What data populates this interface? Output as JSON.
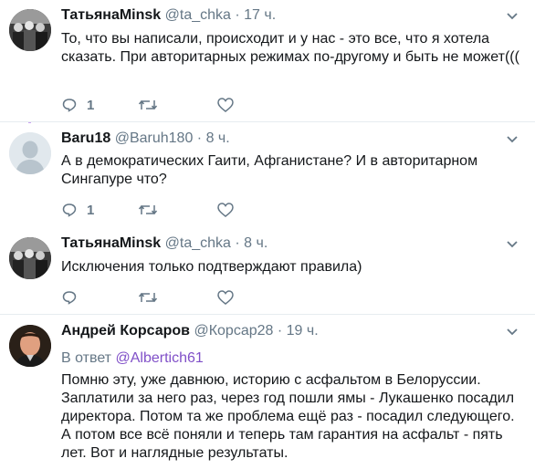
{
  "tweets": [
    {
      "name": "ТатьянаMinsk",
      "handle": "@ta_chka",
      "separator": "·",
      "time": "17 ч.",
      "text": "То, что вы написали, происходит и у нас -  это все, что я хотела сказать. При авторитарных режимах по-другому и быть не может(((",
      "reply_count": "1",
      "avatar_icon": "group-photo-avatar"
    },
    {
      "name": "Baru18",
      "handle": "@Baruh180",
      "separator": "·",
      "time": "8 ч.",
      "text": "А в демократических Гаити,  Афганистане? И в авторитарном Сингапуре что?",
      "reply_count": "1",
      "avatar_icon": "default-user-avatar"
    },
    {
      "name": "ТатьянаMinsk",
      "handle": "@ta_chka",
      "separator": "·",
      "time": "8 ч.",
      "text": "Исключения только подтверждают правила)",
      "reply_count": "",
      "avatar_icon": "group-photo-avatar"
    },
    {
      "name": "Андрей Корсаров",
      "handle": "@Корсар28",
      "separator": "·",
      "time": "19 ч.",
      "reply_prefix": "В ответ",
      "reply_target": "@Albertich61",
      "text": "Помню эту, уже давнюю, историю с асфальтом в Белоруссии. Заплатили за него раз, через год пошли ямы - Лукашенко посадил директора. Потом та же проблема ещё раз  - посадил следующего. А потом все всё поняли и теперь там гарантия на асфальт - пять лет. Вот и наглядные результаты.",
      "avatar_icon": "man-portrait-avatar"
    }
  ],
  "colors": {
    "thread_line": "#c9a1f0",
    "secondary_text": "#657786",
    "link": "#8050c8",
    "divider": "#e6ecf0"
  }
}
